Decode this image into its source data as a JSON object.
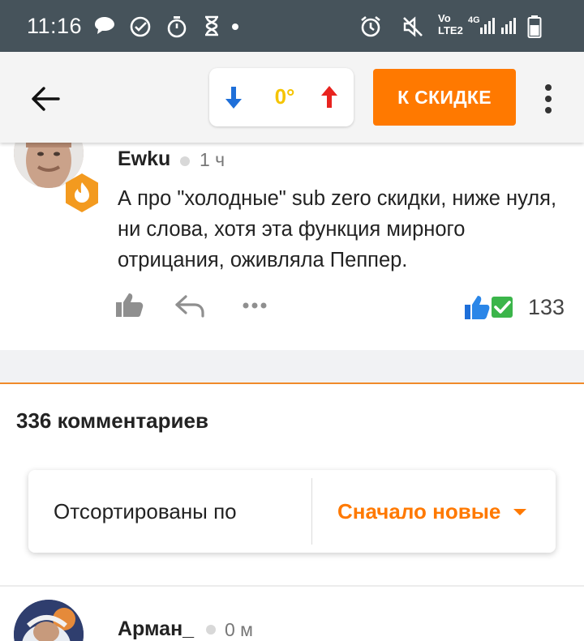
{
  "status_bar": {
    "time": "11:16",
    "icons": [
      "chat-bubble-icon",
      "check-circle-icon",
      "stopwatch-icon",
      "hourglass-icon",
      "alarm-icon",
      "muted-icon",
      "volte-icon",
      "signal-icon",
      "battery-icon"
    ],
    "network_label_top": "Vo",
    "network_label_bottom": "LTE2",
    "network_type": "4G"
  },
  "toolbar": {
    "temperature": "0°",
    "deal_button_label": "К СКИДКЕ",
    "colors": {
      "down": "#1e6fd9",
      "up": "#e8231f",
      "temperature": "#f5c400",
      "cta": "#ff7900"
    }
  },
  "comment": {
    "user": "Ewku",
    "time": "1 ч",
    "text": "А про \"холодные\" sub zero скидки, ниже нуля, ни слова, хотя эта функция мирного отрицания, оживляла Пеппер.",
    "reaction_count": "133"
  },
  "comments_section": {
    "title": "336 комментариев",
    "sort_label": "Отсортированы по",
    "sort_value": "Сначало новые"
  },
  "next_comment": {
    "user": "Арман_",
    "time": "0 м"
  }
}
